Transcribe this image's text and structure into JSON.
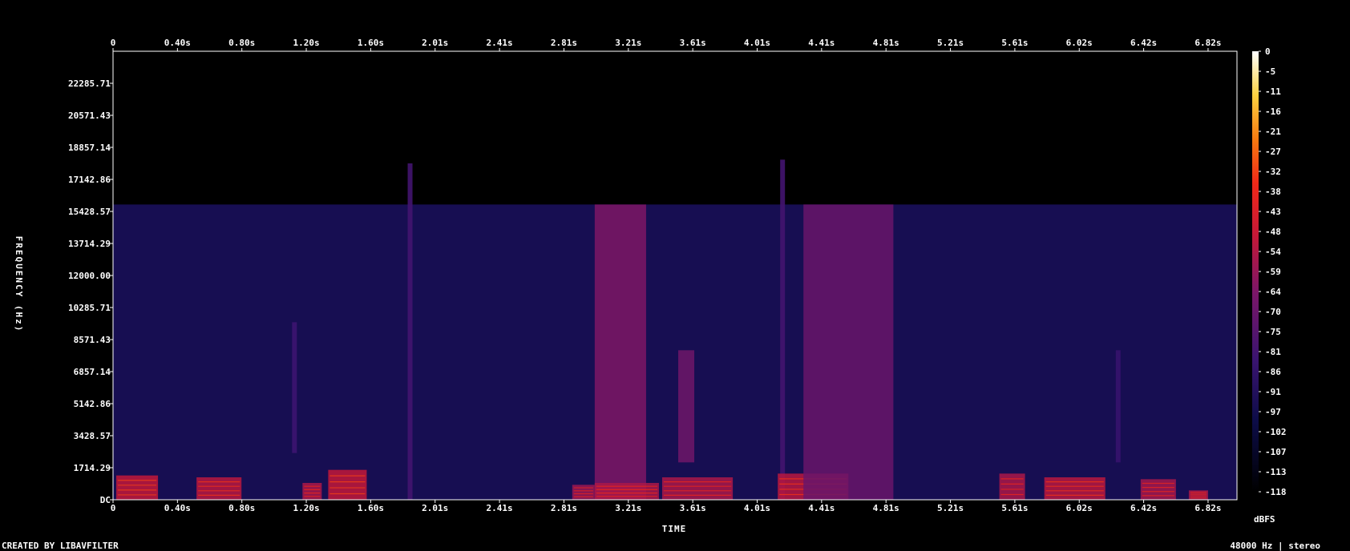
{
  "chart_data": {
    "type": "heatmap",
    "title": "",
    "xlabel": "TIME",
    "ylabel": "FREQUENCY (Hz)",
    "x_tick_labels": [
      "0",
      "0.40s",
      "0.80s",
      "1.20s",
      "1.60s",
      "2.01s",
      "2.41s",
      "2.81s",
      "3.21s",
      "3.61s",
      "4.01s",
      "4.41s",
      "4.81s",
      "5.21s",
      "5.61s",
      "6.02s",
      "6.42s",
      "6.82s"
    ],
    "y_tick_labels": [
      "DC",
      "1714.29",
      "3428.57",
      "5142.86",
      "6857.14",
      "8571.43",
      "10285.71",
      "12000.00",
      "13714.29",
      "15428.57",
      "17142.86",
      "18857.14",
      "20571.43",
      "22285.71"
    ],
    "colorbar_tick_labels": [
      "0",
      "-5",
      "-11",
      "-16",
      "-21",
      "-27",
      "-32",
      "-38",
      "-43",
      "-48",
      "-54",
      "-59",
      "-64",
      "-70",
      "-75",
      "-81",
      "-86",
      "-91",
      "-97",
      "-102",
      "-107",
      "-113",
      "-118"
    ],
    "colorbar_label": "dBFS",
    "xlim": [
      0,
      7.0
    ],
    "ylim": [
      0,
      24000
    ],
    "colorbar_range": [
      -118,
      0
    ],
    "noise_floor_cutoff_hz": 15800,
    "background_level_dbfs": -95,
    "energy_bands": [
      {
        "t0": 0.02,
        "t1": 0.28,
        "f0": 0,
        "f1": 1300,
        "level": -50
      },
      {
        "t0": 0.52,
        "t1": 0.8,
        "f0": 0,
        "f1": 1200,
        "level": -52
      },
      {
        "t0": 1.18,
        "t1": 1.3,
        "f0": 0,
        "f1": 900,
        "level": -55
      },
      {
        "t0": 1.34,
        "t1": 1.58,
        "f0": 0,
        "f1": 1600,
        "level": -50
      },
      {
        "t0": 2.86,
        "t1": 3.0,
        "f0": 0,
        "f1": 800,
        "level": -58
      },
      {
        "t0": 3.0,
        "t1": 3.32,
        "f0": 0,
        "f1": 15800,
        "level": -64
      },
      {
        "t0": 3.0,
        "t1": 3.4,
        "f0": 0,
        "f1": 900,
        "level": -55
      },
      {
        "t0": 3.52,
        "t1": 3.62,
        "f0": 2000,
        "f1": 8000,
        "level": -68
      },
      {
        "t0": 3.42,
        "t1": 3.86,
        "f0": 0,
        "f1": 1200,
        "level": -55
      },
      {
        "t0": 4.14,
        "t1": 4.58,
        "f0": 0,
        "f1": 1400,
        "level": -52
      },
      {
        "t0": 4.3,
        "t1": 4.86,
        "f0": 0,
        "f1": 15800,
        "level": -70
      },
      {
        "t0": 5.52,
        "t1": 5.68,
        "f0": 0,
        "f1": 1400,
        "level": -55
      },
      {
        "t0": 5.8,
        "t1": 6.18,
        "f0": 0,
        "f1": 1200,
        "level": -52
      },
      {
        "t0": 6.4,
        "t1": 6.62,
        "f0": 0,
        "f1": 1100,
        "level": -56
      },
      {
        "t0": 6.7,
        "t1": 6.82,
        "f0": 0,
        "f1": 500,
        "level": -55
      }
    ],
    "transients": [
      {
        "t": 1.85,
        "f0": 0,
        "f1": 18000,
        "level": -80
      },
      {
        "t": 4.17,
        "f0": 0,
        "f1": 18200,
        "level": -80
      },
      {
        "t": 1.13,
        "f0": 2500,
        "f1": 9500,
        "level": -82
      },
      {
        "t": 6.26,
        "f0": 2000,
        "f1": 8000,
        "level": -84
      }
    ]
  },
  "footer": {
    "left": "CREATED BY LIBAVFILTER",
    "right": "48000 Hz | stereo"
  },
  "colors": {
    "background": "#000000",
    "frame": "#ffffff"
  }
}
